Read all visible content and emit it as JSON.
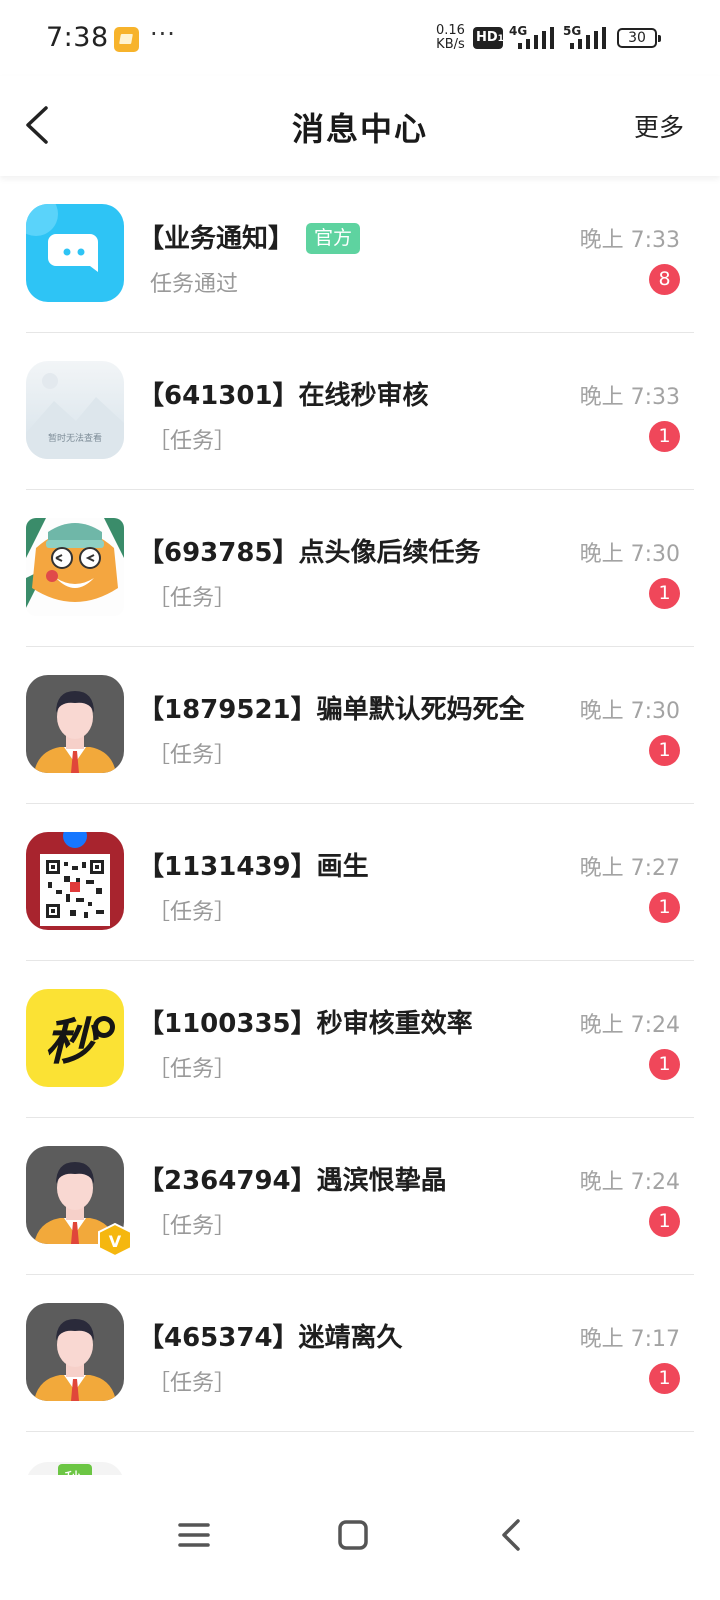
{
  "status_bar": {
    "time": "7:38",
    "speed_value": "0.16",
    "speed_unit": "KB/s",
    "hd_label": "HD",
    "hd_sub": "1",
    "network_4g": "4G",
    "network_5g": "5G",
    "battery": "30"
  },
  "header": {
    "title": "消息中心",
    "more_label": "更多"
  },
  "messages": [
    {
      "title": "【业务通知】",
      "tag": "官方",
      "subtitle": "任务通过",
      "time": "晚上 7:33",
      "unread": "8"
    },
    {
      "title": "【641301】在线秒审核",
      "subtitle": "［任务］",
      "time": "晚上 7:33",
      "unread": "1",
      "avatar_caption": "暂时无法查看"
    },
    {
      "title": "【693785】点头像后续任务",
      "subtitle": "［任务］",
      "time": "晚上 7:30",
      "unread": "1"
    },
    {
      "title": "【1879521】骗单默认死妈死全",
      "subtitle": "［任务］",
      "time": "晚上 7:30",
      "unread": "1"
    },
    {
      "title": "【1131439】画生",
      "subtitle": "［任务］",
      "time": "晚上 7:27",
      "unread": "1"
    },
    {
      "title": "【1100335】秒审核重效率",
      "subtitle": "［任务］",
      "time": "晚上 7:24",
      "unread": "1",
      "avatar_text": "秒"
    },
    {
      "title": "【2364794】遇滨恨挚晶",
      "subtitle": "［任务］",
      "time": "晚上 7:24",
      "unread": "1",
      "vip_mark": "V"
    },
    {
      "title": "【465374】迷靖离久",
      "subtitle": "［任务］",
      "time": "晚上 7:17",
      "unread": "1"
    }
  ],
  "partial_item": {
    "avatar_text": "秒"
  },
  "icons": {
    "back": "back-arrow-icon",
    "menu": "menu-icon",
    "home": "home-icon",
    "sys_back": "system-back-icon"
  },
  "colors": {
    "badge": "#f0475a",
    "official_tag": "#5ed3a0",
    "primary_avatar": "#2ec4f5"
  }
}
